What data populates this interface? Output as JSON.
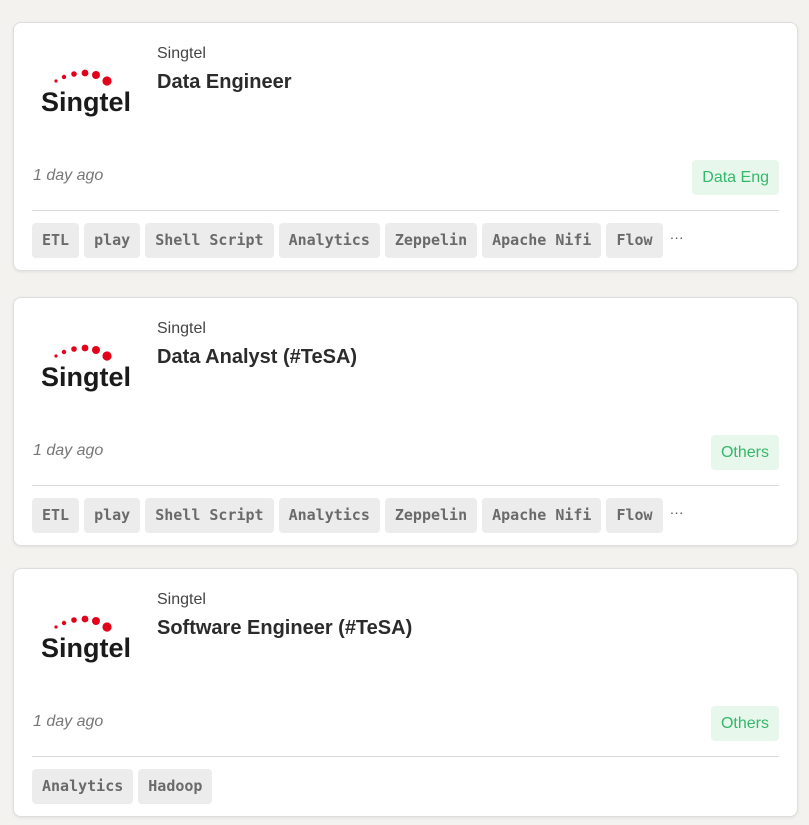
{
  "colors": {
    "logo_red": "#e3001b",
    "logo_text": "#1a1a1a",
    "category_text": "#34b86a",
    "category_bg": "#e8f7ec",
    "tag_bg": "#ececec"
  },
  "jobs": [
    {
      "company": "Singtel",
      "logo_text": "Singtel",
      "title": "Data Engineer",
      "posted": "1 day ago",
      "category": "Data Eng",
      "tags": [
        "ETL",
        "play",
        "Shell Script",
        "Analytics",
        "Zeppelin",
        "Apache Nifi",
        "Flow"
      ],
      "more": "···"
    },
    {
      "company": "Singtel",
      "logo_text": "Singtel",
      "title": "Data Analyst (#TeSA)",
      "posted": "1 day ago",
      "category": "Others",
      "tags": [
        "ETL",
        "play",
        "Shell Script",
        "Analytics",
        "Zeppelin",
        "Apache Nifi",
        "Flow"
      ],
      "more": "···"
    },
    {
      "company": "Singtel",
      "logo_text": "Singtel",
      "title": "Software Engineer (#TeSA)",
      "posted": "1 day ago",
      "category": "Others",
      "tags": [
        "Analytics",
        "Hadoop"
      ],
      "more": ""
    }
  ]
}
